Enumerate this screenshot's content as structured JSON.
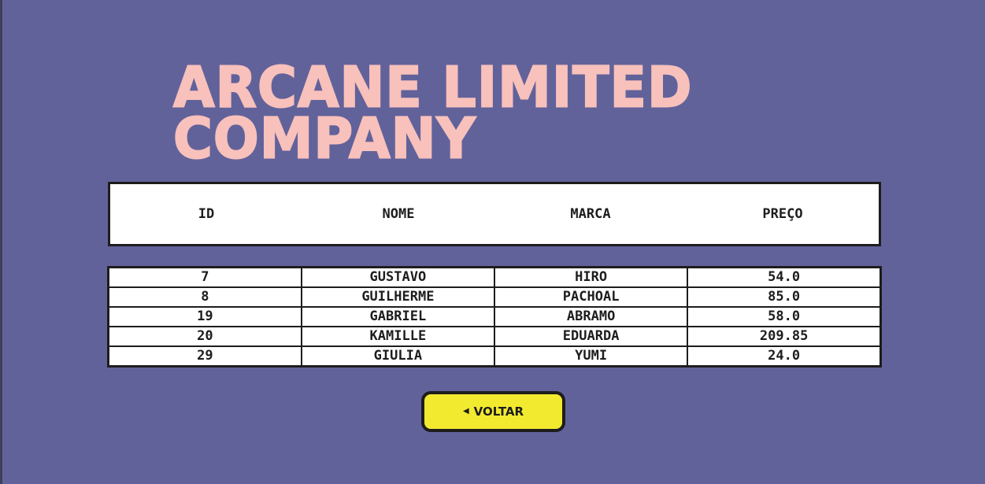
{
  "title": {
    "line1": "ARCANE LIMITED",
    "line2": "COMPANY"
  },
  "table": {
    "headers": [
      "ID",
      "NOME",
      "MARCA",
      "PREÇO"
    ],
    "rows": [
      [
        "7",
        "GUSTAVO",
        "HIRO",
        "54.0"
      ],
      [
        "8",
        "GUILHERME",
        "PACHOAL",
        "85.0"
      ],
      [
        "19",
        "GABRIEL",
        "ABRAMO",
        "58.0"
      ],
      [
        "20",
        "KAMILLE",
        "EDUARDA",
        "209.85"
      ],
      [
        "29",
        "GIULIA",
        "YUMI",
        "24.0"
      ]
    ]
  },
  "back_button": {
    "label": "VOLTAR",
    "icon": "back-arrow-icon"
  },
  "colors": {
    "background": "#62629b",
    "title": "#f8c1bb",
    "button": "#f2ea2f",
    "border": "#1d1d1d"
  }
}
